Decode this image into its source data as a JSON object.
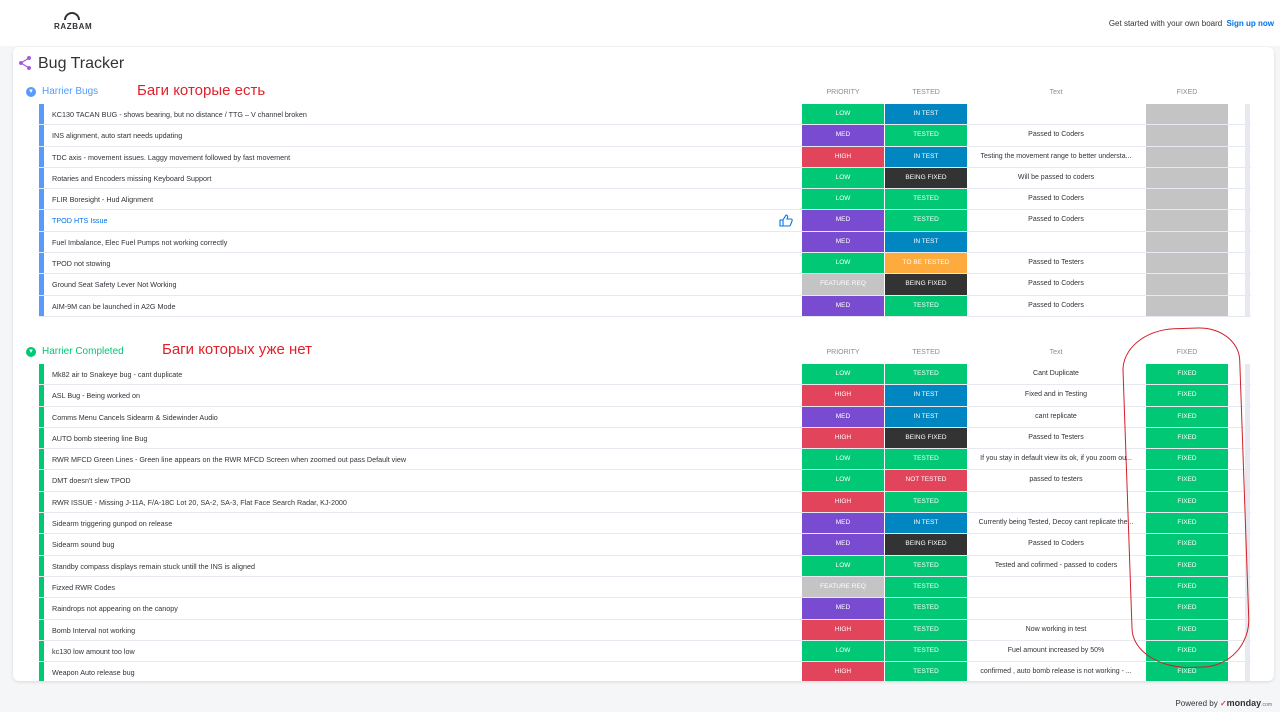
{
  "header": {
    "logo_text": "RAZBAM",
    "cta_text": "Get started with your own board",
    "cta_link": "Sign up now"
  },
  "board": {
    "title": "Bug Tracker"
  },
  "colors": {
    "low": "#00c875",
    "med": "#784bd1",
    "high": "#e2445c",
    "feature": "#c4c4c4",
    "in_test": "#0086c0",
    "tested": "#00c875",
    "being_fixed": "#333333",
    "to_be_tested": "#fdab3d",
    "not_tested": "#e2445c",
    "fixed": "#00c875",
    "empty_fixed": "#c4c4c4",
    "group_active": "#579bfc",
    "group_done": "#00c875",
    "annotation": "#e2202b"
  },
  "groups": [
    {
      "title": "Harrier Bugs",
      "annotation": "Баги которые есть",
      "columns": {
        "priority": "PRIORITY",
        "tested": "TESTED",
        "text": "Text",
        "fixed": "FIXED"
      },
      "rows": [
        {
          "name": "KC130 TACAN BUG - shows bearing, but no distance / TTG – V channel broken",
          "priority": "LOW",
          "priority_color": "low",
          "tested": "IN TEST",
          "tested_color": "in_test",
          "text": "",
          "fixed": ""
        },
        {
          "name": "INS alignment, auto start needs updating",
          "priority": "MED",
          "priority_color": "med",
          "tested": "TESTED",
          "tested_color": "tested",
          "text": "Passed to Coders",
          "fixed": ""
        },
        {
          "name": "TDC axis - movement issues. Laggy movement followed by fast movement",
          "priority": "HIGH",
          "priority_color": "high",
          "tested": "IN TEST",
          "tested_color": "in_test",
          "text": "Testing the movement range to better understa...",
          "fixed": ""
        },
        {
          "name": "Rotaries and Encoders missing Keyboard Support",
          "priority": "LOW",
          "priority_color": "low",
          "tested": "BEING FIXED",
          "tested_color": "being_fixed",
          "text": "Will be passed to coders",
          "fixed": ""
        },
        {
          "name": "FLIR Boresight - Hud Alignment",
          "priority": "LOW",
          "priority_color": "low",
          "tested": "TESTED",
          "tested_color": "tested",
          "text": "Passed to Coders",
          "fixed": ""
        },
        {
          "name": "TPOD HTS Issue",
          "link": true,
          "liked": true,
          "priority": "MED",
          "priority_color": "med",
          "tested": "TESTED",
          "tested_color": "tested",
          "text": "Passed to Coders",
          "fixed": ""
        },
        {
          "name": "Fuel Imbalance, Elec Fuel Pumps not working correctly",
          "priority": "MED",
          "priority_color": "med",
          "tested": "IN TEST",
          "tested_color": "in_test",
          "text": "",
          "fixed": ""
        },
        {
          "name": "TPOD not stowing",
          "priority": "LOW",
          "priority_color": "low",
          "tested": "TO BE TESTED",
          "tested_color": "to_be_tested",
          "text": "Passed to Testers",
          "fixed": ""
        },
        {
          "name": "Ground Seat Safety Lever Not Working",
          "priority": "FEATURE REQ",
          "priority_color": "feature",
          "tested": "BEING FIXED",
          "tested_color": "being_fixed",
          "text": "Passed to Coders",
          "fixed": ""
        },
        {
          "name": "AIM-9M can be launched in A2G Mode",
          "priority": "MED",
          "priority_color": "med",
          "tested": "TESTED",
          "tested_color": "tested",
          "text": "Passed to Coders",
          "fixed": ""
        }
      ]
    },
    {
      "title": "Harrier Completed",
      "annotation": "Баги которых уже нет",
      "columns": {
        "priority": "PRIORITY",
        "tested": "TESTED",
        "text": "Text",
        "fixed": "FIXED"
      },
      "rows": [
        {
          "name": "Mk82 air to Snakeye bug - cant duplicate",
          "priority": "LOW",
          "priority_color": "low",
          "tested": "TESTED",
          "tested_color": "tested",
          "text": "Cant Duplicate",
          "fixed": "FIXED"
        },
        {
          "name": "ASL Bug - Being worked on",
          "priority": "HIGH",
          "priority_color": "high",
          "tested": "IN TEST",
          "tested_color": "in_test",
          "text": "Fixed and in Testing",
          "fixed": "FIXED"
        },
        {
          "name": "Comms Menu Cancels Sidearm & Sidewinder Audio",
          "priority": "MED",
          "priority_color": "med",
          "tested": "IN TEST",
          "tested_color": "in_test",
          "text": "cant replicate",
          "fixed": "FIXED"
        },
        {
          "name": "AUTO bomb steering line Bug",
          "priority": "HIGH",
          "priority_color": "high",
          "tested": "BEING FIXED",
          "tested_color": "being_fixed",
          "text": "Passed to Testers",
          "fixed": "FIXED"
        },
        {
          "name": "RWR MFCD Green Lines - Green line appears on the RWR MFCD Screen when zoomed out pass Default view",
          "priority": "LOW",
          "priority_color": "low",
          "tested": "TESTED",
          "tested_color": "tested",
          "text": "If you stay in default view its ok, if you zoom ou...",
          "fixed": "FIXED"
        },
        {
          "name": "DMT doesn't slew TPOD",
          "priority": "LOW",
          "priority_color": "low",
          "tested": "NOT TESTED",
          "tested_color": "not_tested",
          "text": "passed to testers",
          "fixed": "FIXED"
        },
        {
          "name": "RWR ISSUE - Missing J-11A, F/A-18C Lot 20, SA-2, SA-3, Flat Face Search Radar, KJ-2000",
          "priority": "HIGH",
          "priority_color": "high",
          "tested": "TESTED",
          "tested_color": "tested",
          "text": "",
          "fixed": "FIXED"
        },
        {
          "name": "Sidearm triggering gunpod on release",
          "priority": "MED",
          "priority_color": "med",
          "tested": "IN TEST",
          "tested_color": "in_test",
          "text": "Currently being Tested, Decoy cant replicate the...",
          "fixed": "FIXED"
        },
        {
          "name": "Sidearm sound bug",
          "priority": "MED",
          "priority_color": "med",
          "tested": "BEING FIXED",
          "tested_color": "being_fixed",
          "text": "Passed to Coders",
          "fixed": "FIXED"
        },
        {
          "name": "Standby compass displays remain stuck untill the INS is aligned",
          "priority": "LOW",
          "priority_color": "low",
          "tested": "TESTED",
          "tested_color": "tested",
          "text": "Tested and cofirmed - passed to coders",
          "fixed": "FIXED"
        },
        {
          "name": "Fizxed RWR Codes",
          "priority": "FEATURE REQ",
          "priority_color": "feature",
          "tested": "TESTED",
          "tested_color": "tested",
          "text": "",
          "fixed": "FIXED"
        },
        {
          "name": "Raindrops not appearing on the canopy",
          "priority": "MED",
          "priority_color": "med",
          "tested": "TESTED",
          "tested_color": "tested",
          "text": "",
          "fixed": "FIXED"
        },
        {
          "name": "Bomb Interval not working",
          "priority": "HIGH",
          "priority_color": "high",
          "tested": "TESTED",
          "tested_color": "tested",
          "text": "Now working in test",
          "fixed": "FIXED"
        },
        {
          "name": "kc130 low amount too low",
          "priority": "LOW",
          "priority_color": "low",
          "tested": "TESTED",
          "tested_color": "tested",
          "text": "Fuel amount increased by 50%",
          "fixed": "FIXED"
        },
        {
          "name": "Weapon Auto release bug",
          "priority": "HIGH",
          "priority_color": "high",
          "tested": "TESTED",
          "tested_color": "tested",
          "text": "confirmed , auto bomb release is not working - ...",
          "fixed": "FIXED"
        }
      ]
    }
  ],
  "footer": {
    "powered_by": "Powered by",
    "brand": "monday",
    "brand_suffix": ".com"
  }
}
